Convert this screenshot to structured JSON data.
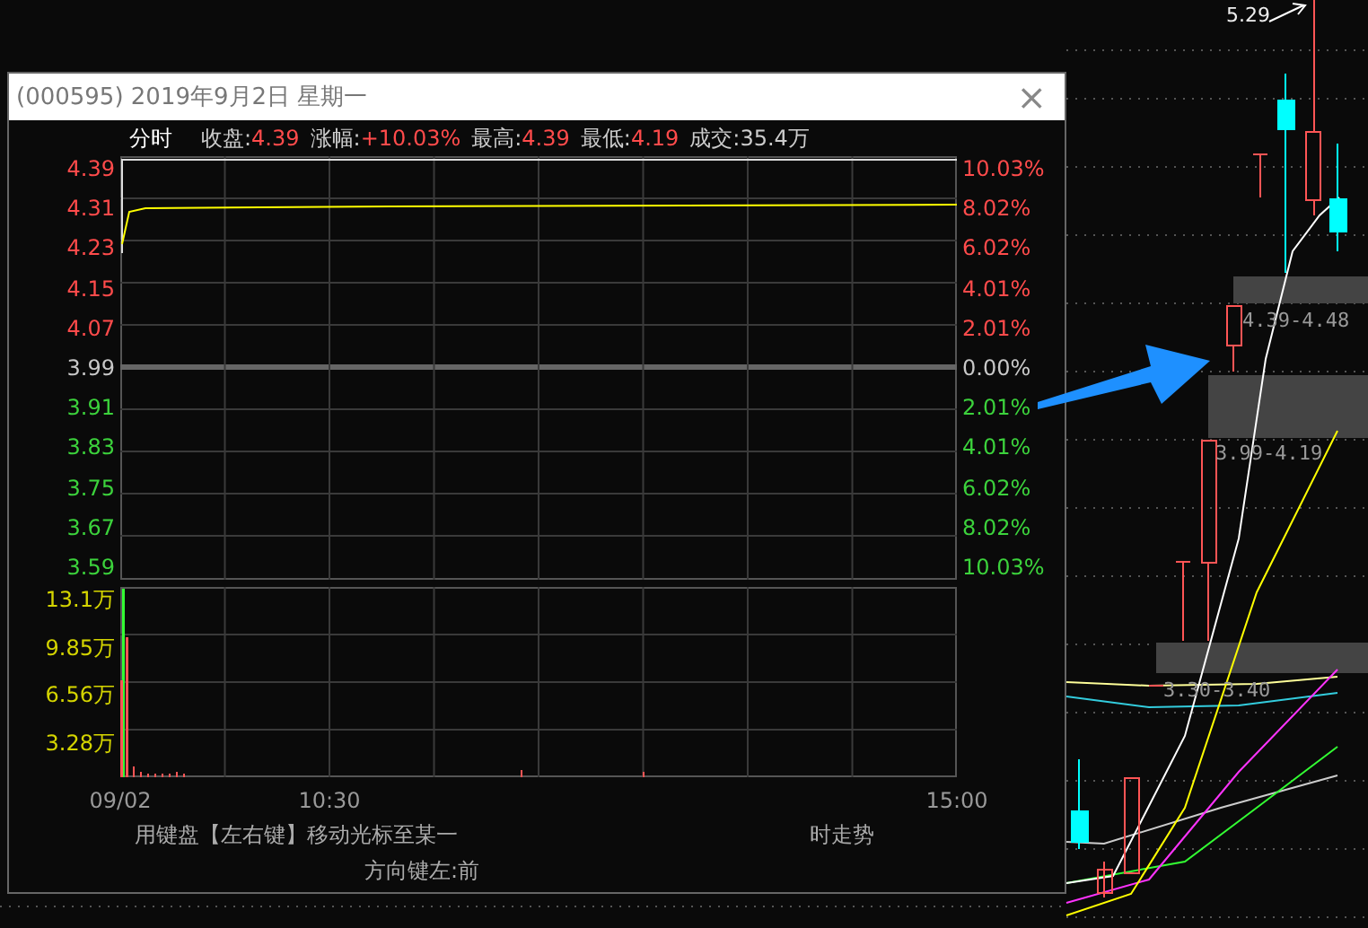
{
  "window": {
    "title": "(000595) 2019年9月2日 星期一",
    "close": "×"
  },
  "quote_bar": {
    "mode": "分时",
    "fields": [
      {
        "label": "收盘:",
        "value": "4.39",
        "kind": "up"
      },
      {
        "label": "涨幅:",
        "value": "+10.03%",
        "kind": "up"
      },
      {
        "label": "最高:",
        "value": "4.39",
        "kind": "up"
      },
      {
        "label": "最低:",
        "value": "4.19",
        "kind": "up"
      },
      {
        "label": "成交:",
        "value": "35.4万",
        "kind": "flat"
      }
    ]
  },
  "price_axis": [
    {
      "text": "4.39",
      "kind": "up"
    },
    {
      "text": "4.31",
      "kind": "up"
    },
    {
      "text": "4.23",
      "kind": "up"
    },
    {
      "text": "4.15",
      "kind": "up"
    },
    {
      "text": "4.07",
      "kind": "up"
    },
    {
      "text": "3.99",
      "kind": "flat"
    },
    {
      "text": "3.91",
      "kind": "down"
    },
    {
      "text": "3.83",
      "kind": "down"
    },
    {
      "text": "3.75",
      "kind": "down"
    },
    {
      "text": "3.67",
      "kind": "down"
    },
    {
      "text": "3.59",
      "kind": "down"
    }
  ],
  "percent_axis": [
    {
      "text": "10.03%",
      "kind": "up"
    },
    {
      "text": "8.02%",
      "kind": "up"
    },
    {
      "text": "6.02%",
      "kind": "up"
    },
    {
      "text": "4.01%",
      "kind": "up"
    },
    {
      "text": "2.01%",
      "kind": "up"
    },
    {
      "text": "0.00%",
      "kind": "flat"
    },
    {
      "text": "2.01%",
      "kind": "down"
    },
    {
      "text": "4.01%",
      "kind": "down"
    },
    {
      "text": "6.02%",
      "kind": "down"
    },
    {
      "text": "8.02%",
      "kind": "down"
    },
    {
      "text": "10.03%",
      "kind": "down"
    }
  ],
  "volume_axis": [
    "13.1万",
    "9.85万",
    "6.56万",
    "3.28万"
  ],
  "time_axis": [
    "09/02",
    "10:30",
    "15:00"
  ],
  "hints": [
    {
      "parts": [
        "用键盘【左右键】移动光标至某一",
        "时走势"
      ]
    },
    {
      "parts": [
        "方向键左:前"
      ]
    }
  ],
  "background_chart": {
    "labels": [
      "5.29",
      "4.39-4.48",
      "3.99-4.19",
      "3.30-3.40"
    ]
  }
}
